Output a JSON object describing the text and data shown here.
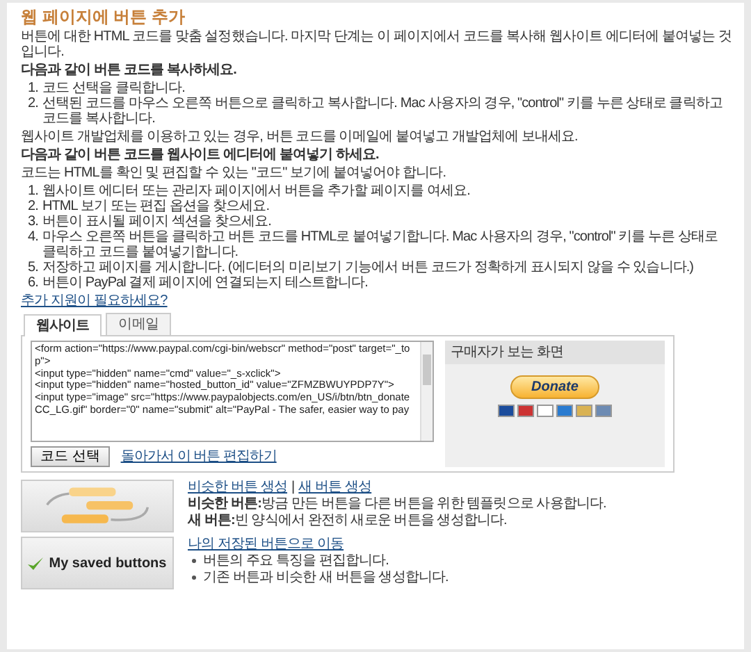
{
  "title": "웹 페이지에 버튼 추가",
  "intro": "버튼에 대한 HTML 코드를 맞춤 설정했습니다. 마지막 단계는 이 페이지에서 코드를 복사해 웹사이트 에디터에 붙여넣는 것입니다.",
  "copy_section": {
    "heading": "다음과 같이 버튼 코드를 복사하세요.",
    "steps": [
      {
        "number": "1.",
        "text": "코드 선택을 클릭합니다."
      },
      {
        "number": "2.",
        "text": "선택된 코드를 마우스 오른쪽 버튼으로 클릭하고 복사합니다. Mac 사용자의 경우, \"control\" 키를 누른 상태로 클릭하고 코드를 복사합니다."
      }
    ],
    "note": "웹사이트 개발업체를 이용하고 있는 경우, 버튼 코드를 이메일에 붙여넣고 개발업체에 보내세요."
  },
  "paste_section": {
    "heading": "다음과 같이 버튼 코드를 웹사이트 에디터에 붙여넣기 하세요.",
    "note": "코드는 HTML를 확인 및 편집할 수 있는 \"코드\" 보기에 붙여넣어야 합니다.",
    "steps": [
      {
        "number": "1.",
        "text": "웹사이트 에디터 또는 관리자 페이지에서 버튼을 추가할 페이지를 여세요."
      },
      {
        "number": "2.",
        "text": "HTML 보기 또는 편집 옵션을 찾으세요."
      },
      {
        "number": "3.",
        "text": "버튼이 표시될 페이지 섹션을 찾으세요."
      },
      {
        "number": "4.",
        "text": "마우스 오른쪽 버튼을 클릭하고 버튼 코드를 HTML로 붙여넣기합니다. Mac 사용자의 경우, \"control\" 키를 누른 상태로 클릭하고 코드를 붙여넣기합니다."
      },
      {
        "number": "5.",
        "text": "저장하고 페이지를 게시합니다. (에디터의 미리보기 기능에서 버튼 코드가 정확하게 표시되지 않을 수 있습니다.)"
      },
      {
        "number": "6.",
        "text": "버튼이 PayPal 결제 페이지에 연결되는지 테스트합니다."
      }
    ]
  },
  "help_link": "추가 지원이 필요하세요?",
  "tabs": [
    {
      "label": "웹사이트",
      "selected": true
    },
    {
      "label": "이메일",
      "selected": false
    }
  ],
  "code": "<form action=\"https://www.paypal.com/cgi-bin/webscr\" method=\"post\" target=\"_top\">\n<input type=\"hidden\" name=\"cmd\" value=\"_s-xclick\">\n<input type=\"hidden\" name=\"hosted_button_id\" value=\"ZFMZBWUYPDP7Y\">\n<input type=\"image\" src=\"https://www.paypalobjects.com/en_US/i/btn/btn_donateCC_LG.gif\" border=\"0\" name=\"submit\" alt=\"PayPal - The safer, easier way to pay",
  "select_button": "코드 선택",
  "edit_link": "돌아가서 이 버튼 편집하기",
  "preview": {
    "title": "구매자가 보는 화면",
    "button": "Donate"
  },
  "options": [
    {
      "kind": "similar",
      "links": [
        "비슷한 버튼 생성",
        "새 버튼 생성"
      ],
      "separator": "|",
      "lines": [
        "**비슷한 버튼:**방금 만든 버튼을 다른 버튼을 위한 템플릿으로 사용합니다.",
        "**새 버튼:**빈 양식에서 완전히 새로운 버튼을 생성합니다."
      ]
    },
    {
      "kind": "saved",
      "image_label": "My saved buttons",
      "links": [
        "나의 저장된 버튼으로 이동"
      ],
      "bullets": [
        "버튼의 주요 특징을 편집합니다.",
        "기존 버튼과 비슷한 새 버튼을 생성합니다."
      ]
    }
  ]
}
